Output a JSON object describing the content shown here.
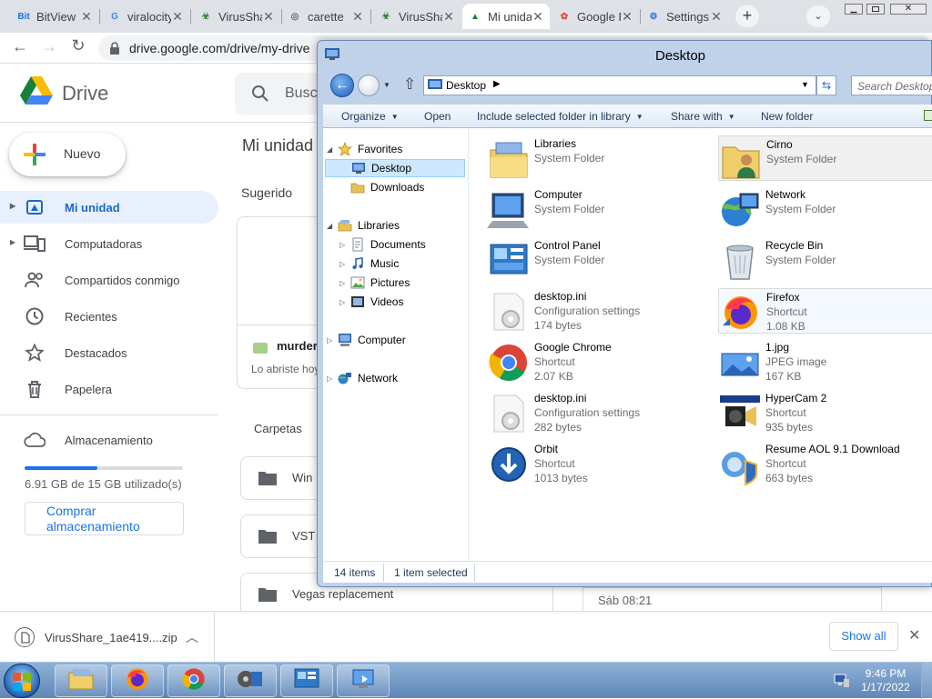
{
  "browser": {
    "tabs": [
      {
        "label": "BitView",
        "fav": "Bit",
        "color": "#1a73e8",
        "icon": "bitview-icon"
      },
      {
        "label": "viralocity",
        "fav": "G",
        "color": "#4285f4",
        "icon": "google-icon"
      },
      {
        "label": "VirusShare",
        "fav": "☣",
        "color": "#2e7d32",
        "icon": "biohazard-icon"
      },
      {
        "label": "carette",
        "fav": "◎",
        "color": "#5f6368",
        "icon": "globe-icon"
      },
      {
        "label": "VirusShare",
        "fav": "☣",
        "color": "#2e7d32",
        "icon": "biohazard-icon"
      },
      {
        "label": "Mi unidad",
        "fav": "▲",
        "color": "#188038",
        "icon": "drive-icon",
        "active": true
      },
      {
        "label": "Google Photos",
        "fav": "✿",
        "color": "#ea4335",
        "icon": "photos-icon"
      },
      {
        "label": "Settings",
        "fav": "⚙",
        "color": "#1a73e8",
        "icon": "gear-icon"
      }
    ],
    "new_tab": "+",
    "url": "drive.google.com/drive/my-drive"
  },
  "drive": {
    "brand": "Drive",
    "search_placeholder": "Buscar en Drive",
    "new_button": "Nuevo",
    "nav": [
      {
        "label": "Mi unidad",
        "icon": "my-drive-icon",
        "active": true,
        "expand": true
      },
      {
        "label": "Computadoras",
        "icon": "computers-icon",
        "expand": true
      },
      {
        "label": "Compartidos conmigo",
        "icon": "shared-icon"
      },
      {
        "label": "Recientes",
        "icon": "clock-icon"
      },
      {
        "label": "Destacados",
        "icon": "star-icon"
      },
      {
        "label": "Papelera",
        "icon": "trash-icon"
      }
    ],
    "storage": {
      "label": "Almacenamiento",
      "used_text": "6.91 GB de 15 GB utilizado(s)",
      "fraction": 0.46,
      "buy_button": "Comprar almacenamiento"
    },
    "header_title": "Mi unidad",
    "suggested_label": "Sugerido",
    "suggested_file": {
      "name": "murder.",
      "subtitle": "Lo abriste hoy"
    },
    "folders_label": "Carpetas",
    "folders": [
      {
        "name": "Win"
      },
      {
        "name": "VST"
      },
      {
        "name": "Vegas replacement"
      }
    ],
    "date_text": "Sáb 08:21"
  },
  "download_bar": {
    "file": "VirusShare_1ae419....zip",
    "show_all": "Show all"
  },
  "explorer": {
    "title": "Desktop",
    "location": "Desktop",
    "search_placeholder": "Search Desktop",
    "toolbar": [
      "Organize",
      "Open",
      "Include selected folder in library",
      "Share with",
      "New folder"
    ],
    "toolbar_dropdown": [
      true,
      false,
      true,
      true,
      false
    ],
    "tree": [
      {
        "label": "Favorites",
        "icon": "star-icon",
        "level": 0,
        "arrow": "◢"
      },
      {
        "label": "Desktop",
        "icon": "desktop-icon",
        "level": 1,
        "selected": true
      },
      {
        "label": "Downloads",
        "icon": "folder-icon",
        "level": 1
      },
      {
        "label": "Libraries",
        "icon": "libraries-icon",
        "level": 0,
        "arrow": "◢"
      },
      {
        "label": "Documents",
        "icon": "documents-icon",
        "level": 1,
        "arrow": "▷"
      },
      {
        "label": "Music",
        "icon": "music-icon",
        "level": 1,
        "arrow": "▷"
      },
      {
        "label": "Pictures",
        "icon": "pictures-icon",
        "level": 1,
        "arrow": "▷"
      },
      {
        "label": "Videos",
        "icon": "videos-icon",
        "level": 1,
        "arrow": "▷"
      },
      {
        "label": "Computer",
        "icon": "computer-icon",
        "level": 0,
        "arrow": "▷"
      },
      {
        "label": "Network",
        "icon": "network-icon",
        "level": 0,
        "arrow": "▷"
      }
    ],
    "items": [
      {
        "name": "Libraries",
        "type": "System Folder",
        "size": "",
        "icon": "libraries-icon"
      },
      {
        "name": "Cirno",
        "type": "System Folder",
        "size": "",
        "icon": "user-folder-icon",
        "selected": true
      },
      {
        "name": "Computer",
        "type": "System Folder",
        "size": "",
        "icon": "computer-icon"
      },
      {
        "name": "Network",
        "type": "System Folder",
        "size": "",
        "icon": "network-icon"
      },
      {
        "name": "Control Panel",
        "type": "System Folder",
        "size": "",
        "icon": "control-panel-icon"
      },
      {
        "name": "Recycle Bin",
        "type": "System Folder",
        "size": "",
        "icon": "recycle-bin-icon"
      },
      {
        "name": "desktop.ini",
        "type": "Configuration settings",
        "size": "174 bytes",
        "icon": "settings-file-icon"
      },
      {
        "name": "Firefox",
        "type": "Shortcut",
        "size": "1.08 KB",
        "icon": "firefox-icon",
        "hover": true
      },
      {
        "name": "Google Chrome",
        "type": "Shortcut",
        "size": "2.07 KB",
        "icon": "chrome-icon"
      },
      {
        "name": "1.jpg",
        "type": "JPEG image",
        "size": "167 KB",
        "icon": "image-file-icon"
      },
      {
        "name": "desktop.ini",
        "type": "Configuration settings",
        "size": "282 bytes",
        "icon": "settings-file-icon"
      },
      {
        "name": "HyperCam 2",
        "type": "Shortcut",
        "size": "935 bytes",
        "icon": "hypercam-icon"
      },
      {
        "name": "Orbit",
        "type": "Shortcut",
        "size": "1013 bytes",
        "icon": "orbit-icon"
      },
      {
        "name": "Resume AOL 9.1 Download",
        "type": "Shortcut",
        "size": "663 bytes",
        "icon": "aol-icon"
      }
    ],
    "status_count": "14 items",
    "status_selected": "1 item selected"
  },
  "taskbar": {
    "time": "9:46 PM",
    "date": "1/17/2022",
    "buttons": [
      {
        "icon": "explorer-icon"
      },
      {
        "icon": "firefox-icon"
      },
      {
        "icon": "chrome-icon"
      },
      {
        "icon": "media-icon"
      },
      {
        "icon": "control-panel-icon"
      },
      {
        "icon": "hypercam-icon"
      }
    ]
  },
  "colors": {
    "drive_active_bg": "#e8f0fe",
    "drive_active_text": "#1967d2",
    "storage_bar": "#1a73e8",
    "explorer_select": "#cce8ff"
  }
}
